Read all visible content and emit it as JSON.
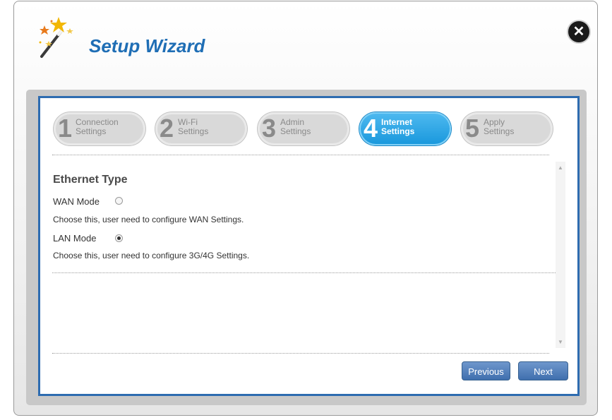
{
  "header": {
    "title": "Setup Wizard",
    "close_icon": "close-icon"
  },
  "steps": [
    {
      "num": "1",
      "label": "Connection\nSettings",
      "active": false
    },
    {
      "num": "2",
      "label": "Wi-Fi\nSettings",
      "active": false
    },
    {
      "num": "3",
      "label": "Admin\nSettings",
      "active": false
    },
    {
      "num": "4",
      "label": "Internet\nSettings",
      "active": true
    },
    {
      "num": "5",
      "label": "Apply\nSettings",
      "active": false
    }
  ],
  "section": {
    "title": "Ethernet Type",
    "wan_label": "WAN Mode",
    "wan_desc": "Choose this, user need to configure WAN Settings.",
    "lan_label": "LAN Mode",
    "lan_desc": "Choose this, user need to configure 3G/4G Settings.",
    "selected": "LAN Mode"
  },
  "buttons": {
    "previous": "Previous",
    "next": "Next"
  },
  "colors": {
    "accent": "#2e6cb0",
    "active_step": "#1897dc"
  }
}
